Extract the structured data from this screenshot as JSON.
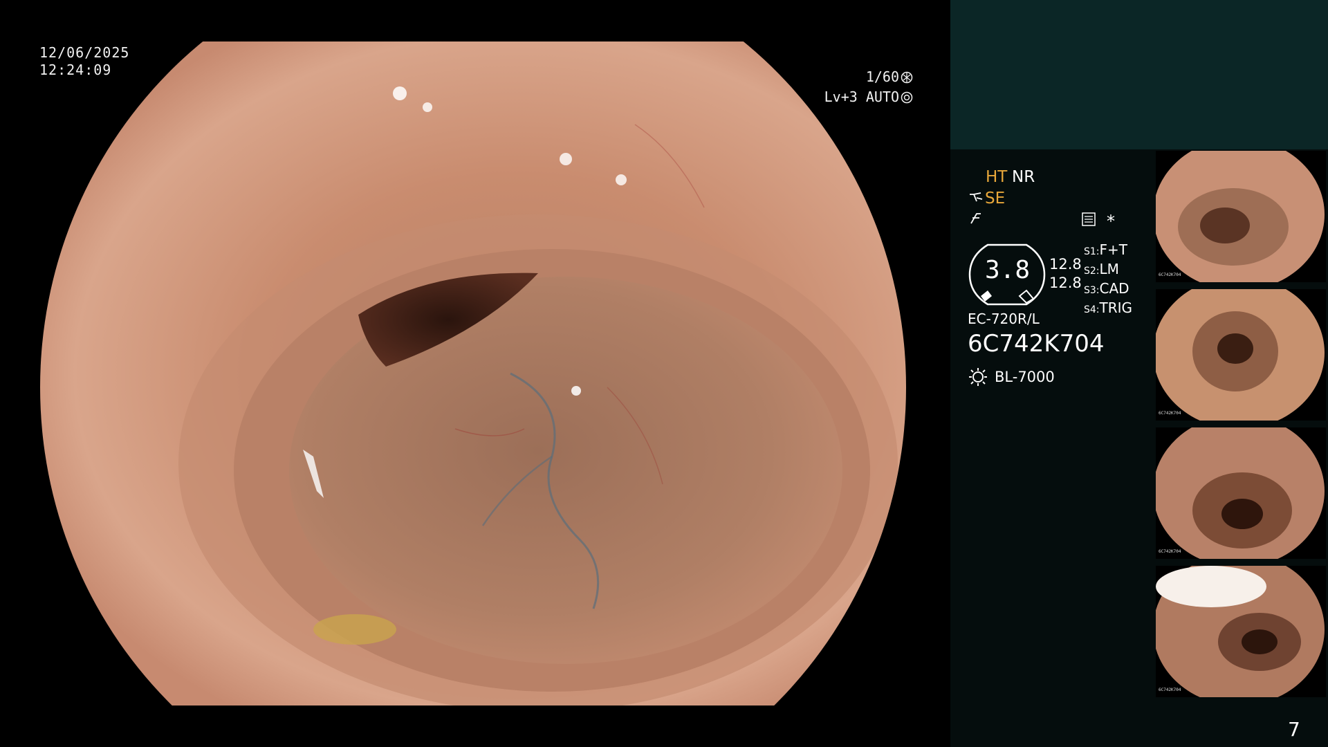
{
  "scope_view": {
    "date": "12/06/2025",
    "time": "12:24:09",
    "shutter": "1/60",
    "level": "Lv+3",
    "exposure_mode": "AUTO",
    "icons": [
      "shutter-icon",
      "auto-exposure-icon"
    ]
  },
  "panel": {
    "ht": "HT",
    "nr": "NR",
    "se": "SE",
    "zoom_value": "3.8",
    "zoom_sub1": "12.8",
    "zoom_sub2": "12.8",
    "switches": [
      {
        "key": "S1:",
        "value": "F+T"
      },
      {
        "key": "S2:",
        "value": "LM"
      },
      {
        "key": "S3:",
        "value": "CAD"
      },
      {
        "key": "S4:",
        "value": "TRIG"
      }
    ],
    "scope_model": "EC-720R/L",
    "serial": "6C742K704",
    "light_source": "BL-7000",
    "asterisk": "*",
    "page_number": "7",
    "colors": {
      "panel_top": "#0b2626",
      "panel_bottom": "#050d0d",
      "accent_orange": "#e8a73a"
    }
  },
  "thumbnails": [
    {
      "serial": "6C742K704"
    },
    {
      "serial": "6C742K704"
    },
    {
      "serial": "6C742K704"
    },
    {
      "serial": "6C742K704"
    }
  ]
}
